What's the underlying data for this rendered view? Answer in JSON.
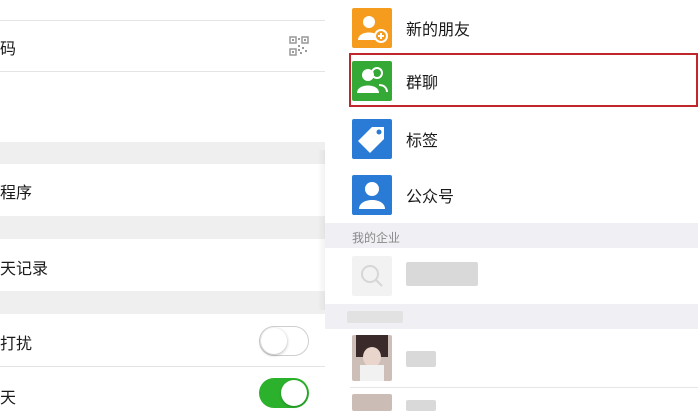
{
  "left_panel": {
    "qr_label": "码",
    "mini_program_label": "程序",
    "chat_history_label": "天记录",
    "do_not_disturb_label": "打扰",
    "pin_chat_label": "天",
    "do_not_disturb_on": false,
    "pin_chat_on": true
  },
  "right_panel": {
    "items": [
      {
        "label": "新的朋友",
        "icon": "person-add-icon",
        "color": "#f59b1d"
      },
      {
        "label": "群聊",
        "icon": "group-icon",
        "color": "#35a935",
        "highlighted": true
      },
      {
        "label": "标签",
        "icon": "tag-icon",
        "color": "#2a7bd5"
      },
      {
        "label": "公众号",
        "icon": "person-icon",
        "color": "#2a7bd5"
      }
    ],
    "section_enterprise": "我的企业"
  },
  "colors": {
    "highlight_border": "#c0262a",
    "toggle_on": "#2bb12b"
  }
}
